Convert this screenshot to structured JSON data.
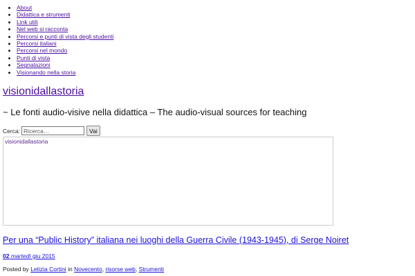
{
  "nav": {
    "items": [
      "About",
      "Didattica e strumenti",
      "Link utili",
      "Nel web si racconta",
      "Percorsi e punti di vista degli studenti",
      "Percorsi italiani",
      "Percorsi nel mondo",
      "Punti di vista",
      "Segnalazioni",
      "Visionando nella storia"
    ]
  },
  "site": {
    "title": "visionidallastoria",
    "tagline": "~ Le fonti audio-visive nella didattica – The audio-visual sources for teaching"
  },
  "search": {
    "label": "Cerca:",
    "placeholder": "Ricerca…",
    "button": "Vai"
  },
  "header_image": {
    "alt_text": "visionidallastoria"
  },
  "post": {
    "title": "Per una “Public History” italiana nei luoghi della Guerra Civile (1943-1945), di Serge Noiret",
    "date_day": "02",
    "date_weekday": "martedì",
    "date_month_year": "giu 2015",
    "posted_by_label": "Posted by",
    "author": "Letizia Cortini",
    "in_label": "in",
    "categories": [
      "Novecento",
      "risorse web",
      "Strumenti"
    ],
    "sep": ","
  },
  "colors": {
    "visited_link": "#4b0fa0",
    "link": "#1a10d6"
  }
}
